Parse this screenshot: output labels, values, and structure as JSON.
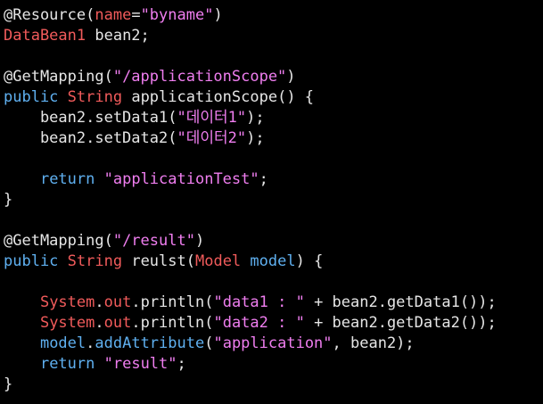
{
  "editor": {
    "lines": [
      [
        {
          "t": "@Resource(",
          "c": "plain"
        },
        {
          "t": "name",
          "c": "param"
        },
        {
          "t": "=",
          "c": "plain"
        },
        {
          "t": "\"byname\"",
          "c": "string"
        },
        {
          "t": ")",
          "c": "plain"
        }
      ],
      [
        {
          "t": "DataBean1",
          "c": "type-red"
        },
        {
          "t": " bean2;",
          "c": "plain"
        }
      ],
      [],
      [
        {
          "t": "@GetMapping(",
          "c": "plain"
        },
        {
          "t": "\"/applicationScope\"",
          "c": "string"
        },
        {
          "t": ")",
          "c": "plain"
        }
      ],
      [
        {
          "t": "public",
          "c": "keyword"
        },
        {
          "t": " ",
          "c": "plain"
        },
        {
          "t": "String",
          "c": "type-red"
        },
        {
          "t": " applicationScope() {",
          "c": "plain"
        }
      ],
      [
        {
          "t": "    bean2.setData1(",
          "c": "plain"
        },
        {
          "t": "\"데이터1\"",
          "c": "string"
        },
        {
          "t": ");",
          "c": "plain"
        }
      ],
      [
        {
          "t": "    bean2.setData2(",
          "c": "plain"
        },
        {
          "t": "\"데이터2\"",
          "c": "string"
        },
        {
          "t": ");",
          "c": "plain"
        }
      ],
      [],
      [
        {
          "t": "    ",
          "c": "plain"
        },
        {
          "t": "return",
          "c": "keyword"
        },
        {
          "t": " ",
          "c": "plain"
        },
        {
          "t": "\"applicationTest\"",
          "c": "string"
        },
        {
          "t": ";",
          "c": "plain"
        }
      ],
      [
        {
          "t": "}",
          "c": "plain"
        }
      ],
      [],
      [
        {
          "t": "@GetMapping(",
          "c": "plain"
        },
        {
          "t": "\"/result\"",
          "c": "string"
        },
        {
          "t": ")",
          "c": "plain"
        }
      ],
      [
        {
          "t": "public",
          "c": "keyword"
        },
        {
          "t": " ",
          "c": "plain"
        },
        {
          "t": "String",
          "c": "type-red"
        },
        {
          "t": " reulst(",
          "c": "plain"
        },
        {
          "t": "Model",
          "c": "type-red"
        },
        {
          "t": " ",
          "c": "plain"
        },
        {
          "t": "model",
          "c": "keyword"
        },
        {
          "t": ") {",
          "c": "plain"
        }
      ],
      [],
      [
        {
          "t": "    ",
          "c": "plain"
        },
        {
          "t": "System",
          "c": "type-red"
        },
        {
          "t": ".",
          "c": "plain"
        },
        {
          "t": "out",
          "c": "type-red"
        },
        {
          "t": ".println(",
          "c": "plain"
        },
        {
          "t": "\"data1 : \"",
          "c": "string"
        },
        {
          "t": " + bean2.getData1());",
          "c": "plain"
        }
      ],
      [
        {
          "t": "    ",
          "c": "plain"
        },
        {
          "t": "System",
          "c": "type-red"
        },
        {
          "t": ".",
          "c": "plain"
        },
        {
          "t": "out",
          "c": "type-red"
        },
        {
          "t": ".println(",
          "c": "plain"
        },
        {
          "t": "\"data2 : \"",
          "c": "string"
        },
        {
          "t": " + bean2.getData2());",
          "c": "plain"
        }
      ],
      [
        {
          "t": "    ",
          "c": "plain"
        },
        {
          "t": "model",
          "c": "keyword"
        },
        {
          "t": ".",
          "c": "plain"
        },
        {
          "t": "addAttribute",
          "c": "keyword"
        },
        {
          "t": "(",
          "c": "plain"
        },
        {
          "t": "\"application\"",
          "c": "string"
        },
        {
          "t": ", bean2);",
          "c": "plain"
        }
      ],
      [
        {
          "t": "    ",
          "c": "plain"
        },
        {
          "t": "return",
          "c": "keyword"
        },
        {
          "t": " ",
          "c": "plain"
        },
        {
          "t": "\"result\"",
          "c": "string"
        },
        {
          "t": ";",
          "c": "plain"
        }
      ],
      [
        {
          "t": "}",
          "c": "plain"
        }
      ]
    ]
  },
  "colors": {
    "background": "#000000",
    "plain": "#e6e6e6",
    "keyword": "#5fb0f0",
    "type": "#f15b5b",
    "string": "#f07ef0"
  }
}
